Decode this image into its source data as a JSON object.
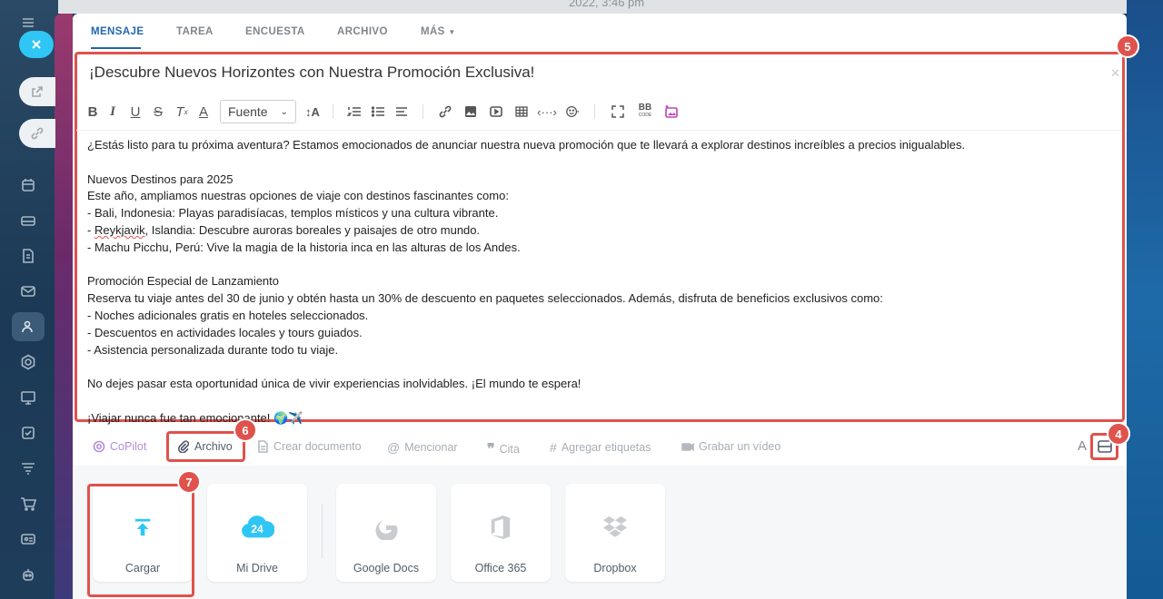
{
  "background": {
    "top_text": "2022, 3:46 pm"
  },
  "tabs": [
    {
      "label": "MENSAJE"
    },
    {
      "label": "TAREA"
    },
    {
      "label": "ENCUESTA"
    },
    {
      "label": "ARCHIVO"
    },
    {
      "label": "MÁS"
    }
  ],
  "editor": {
    "title": "¡Descubre Nuevos Horizontes con Nuestra Promoción Exclusiva!",
    "font_select": "Fuente",
    "body_lines": [
      "¿Estás listo para tu próxima aventura? Estamos emocionados de anunciar nuestra nueva promoción que te llevará a explorar destinos increíbles a precios inigualables.",
      "",
      "Nuevos Destinos para 2025",
      "Este año, ampliamos nuestras opciones de viaje con destinos fascinantes como:",
      "- Bali, Indonesia: Playas paradisíacas, templos místicos y una cultura vibrante.",
      "- Reykjavik, Islandia: Descubre auroras boreales y paisajes de otro mundo.",
      "- Machu Picchu, Perú: Vive la magia de la historia inca en las alturas de los Andes.",
      "",
      "Promoción Especial de Lanzamiento",
      "Reserva tu viaje antes del 30 de junio y obtén hasta un 30% de descuento en paquetes seleccionados. Además, disfruta de beneficios exclusivos como:",
      "- Noches adicionales gratis en hoteles seleccionados.",
      "- Descuentos en actividades locales y tours guiados.",
      "- Asistencia personalizada durante todo tu viaje.",
      "",
      "No dejes pasar esta oportunidad única de vivir experiencias inolvidables. ¡El mundo te espera!",
      "",
      "¡Viajar nunca fue tan emocionante! 🌍✈️"
    ],
    "toolbar_bb_label": "BB",
    "toolbar_bb_sub": "CODE"
  },
  "actions": {
    "copilot": "CoPilot",
    "archivo": "Archivo",
    "crear_documento": "Crear documento",
    "mencionar": "Mencionar",
    "cita": "Cita",
    "etiquetas": "Agregar etiquetas",
    "video": "Grabar un vídeo",
    "font_toggle": "A"
  },
  "upload_tiles": [
    {
      "label": "Cargar",
      "icon": "upload-arrow-icon"
    },
    {
      "label": "Mi Drive",
      "icon": "cloud-24-icon",
      "badge": "24"
    },
    {
      "label": "Google Docs",
      "icon": "google-icon"
    },
    {
      "label": "Office 365",
      "icon": "office-icon"
    },
    {
      "label": "Dropbox",
      "icon": "dropbox-icon"
    }
  ],
  "annotations": [
    "4",
    "5",
    "6",
    "7"
  ],
  "colors": {
    "accent": "#2067b0",
    "highlight": "#e0524c",
    "upload": "#2fc6f6"
  }
}
